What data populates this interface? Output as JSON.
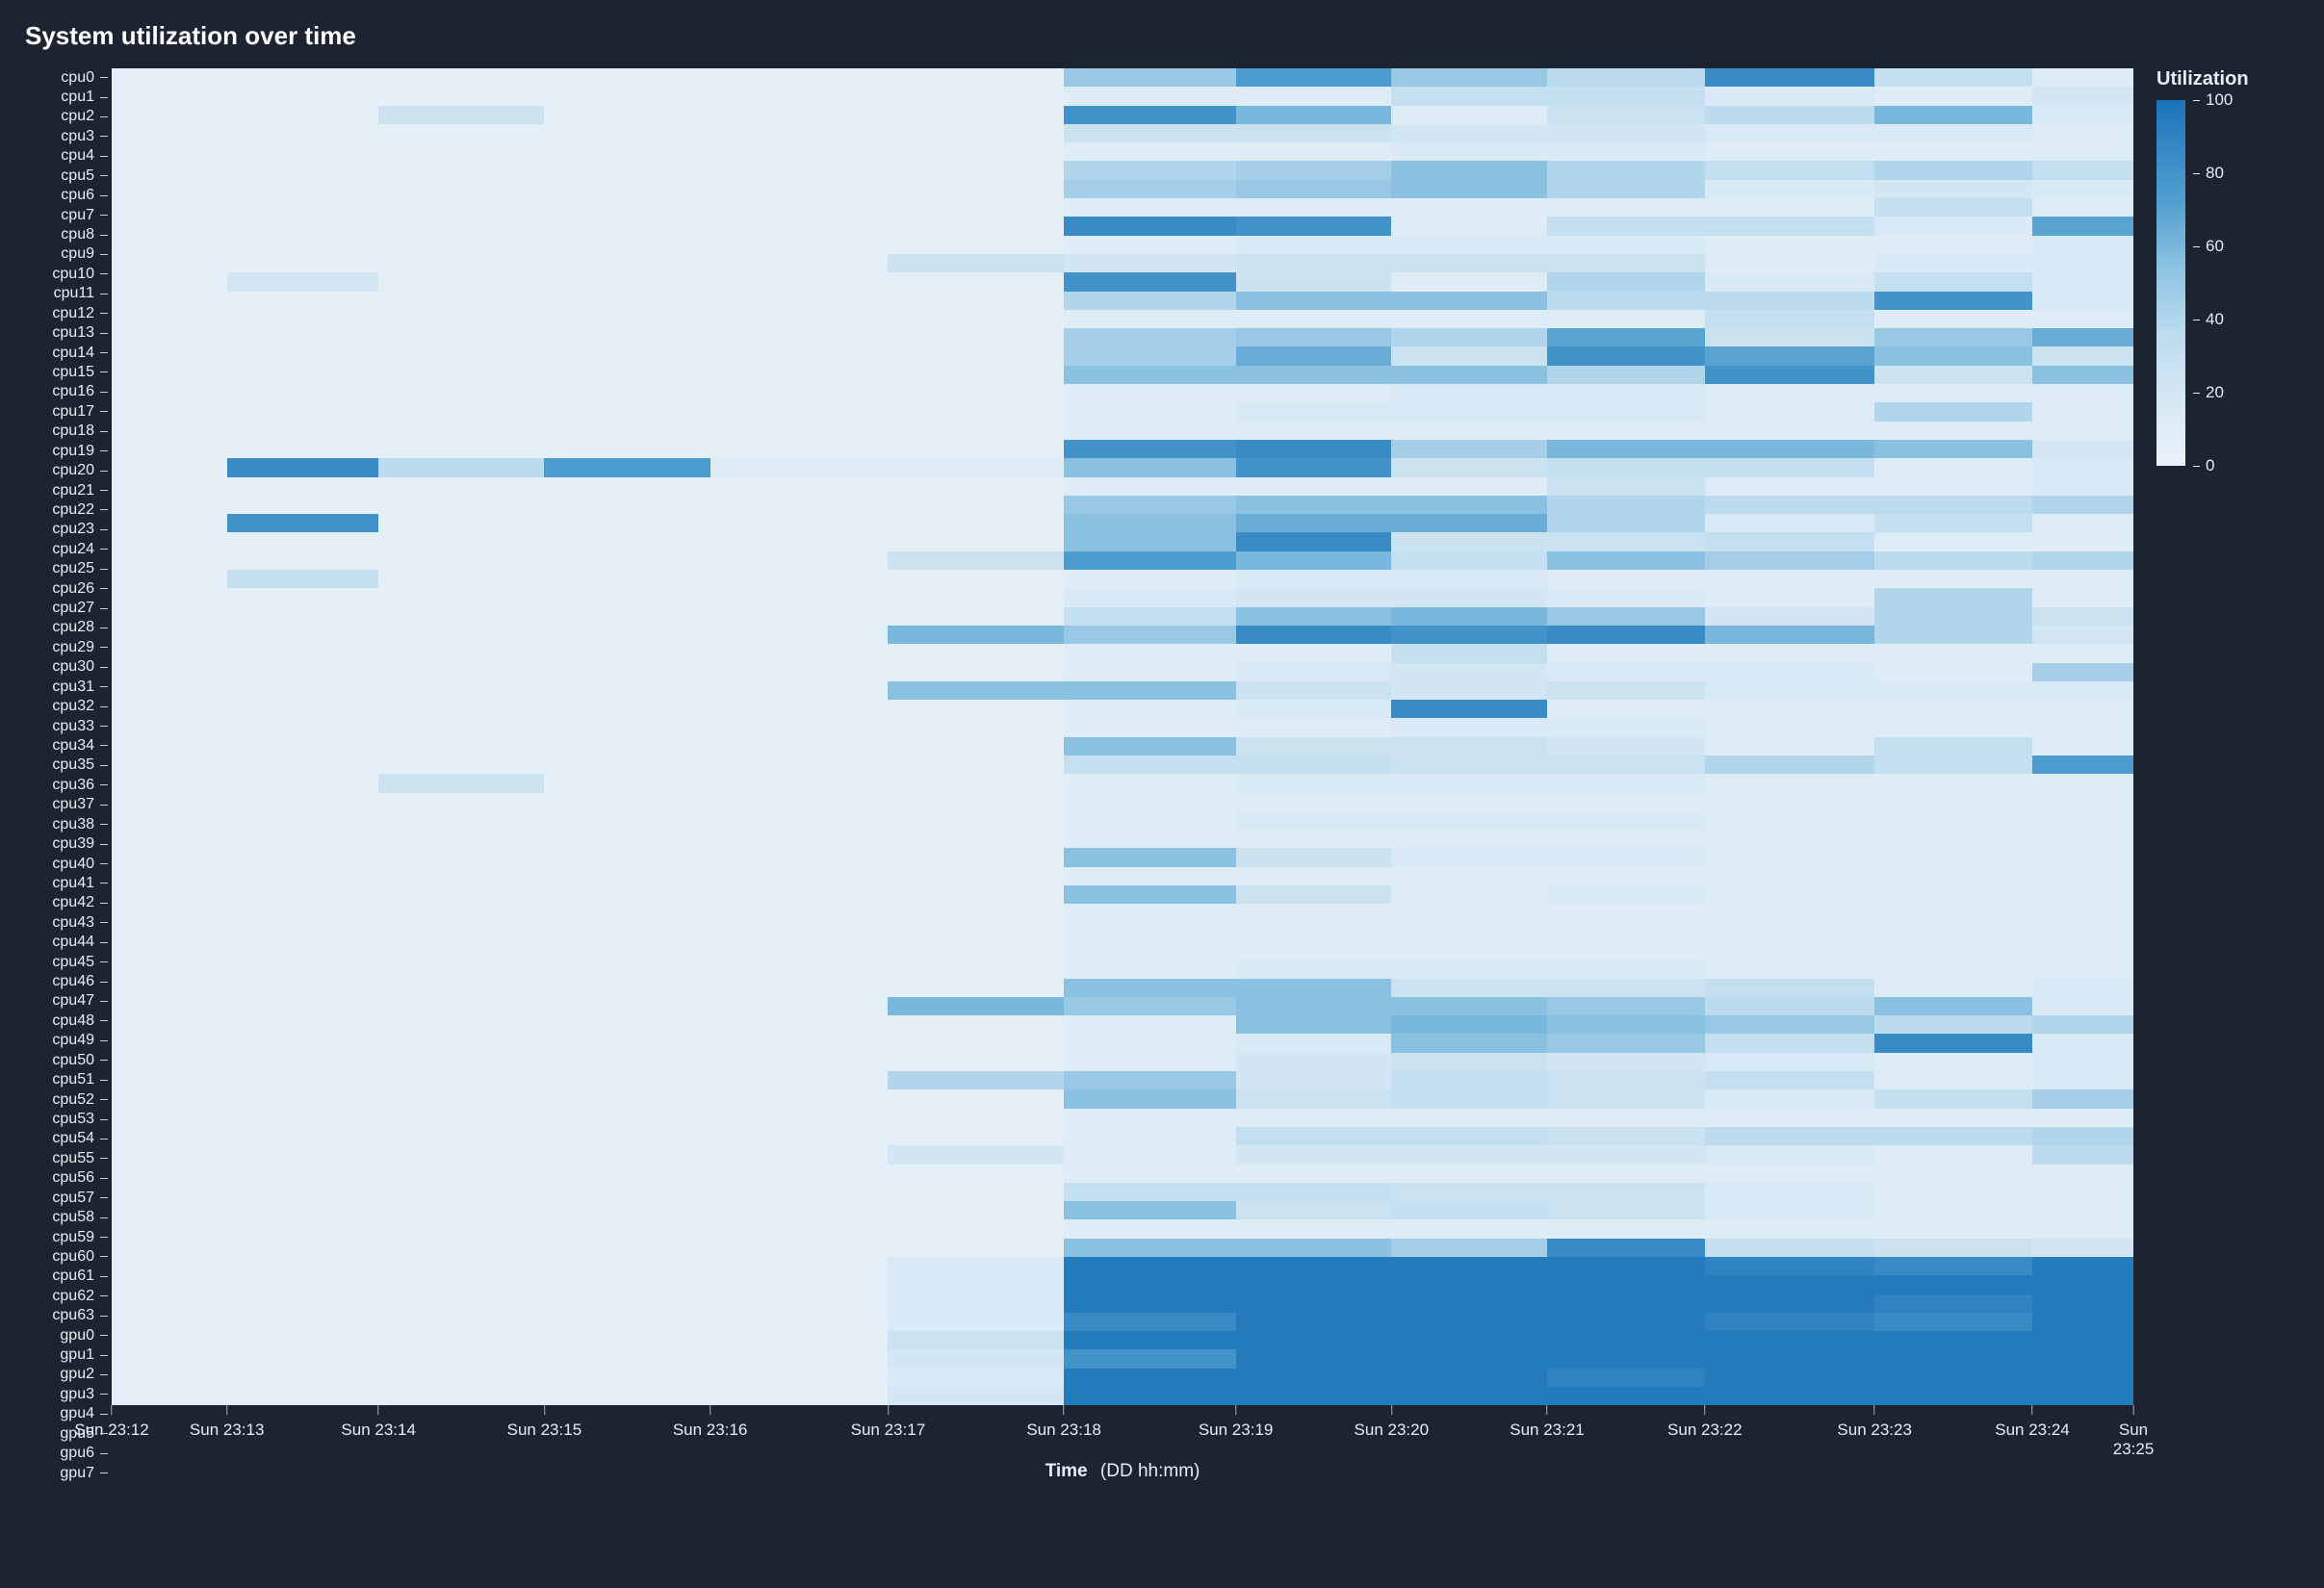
{
  "title": "System utilization over time",
  "xaxis_label_bold": "Time",
  "xaxis_label_rest": "(DD hh:mm)",
  "legend": {
    "title": "Utilization",
    "ticks": [
      0,
      20,
      40,
      60,
      80,
      100
    ],
    "min": 0,
    "max": 100
  },
  "chart_data": {
    "type": "heatmap",
    "title": "System utilization over time",
    "xlabel": "Time (DD hh:mm)",
    "legend_label": "Utilization",
    "color_scale": {
      "min": 0,
      "max": 100
    },
    "x_categories": [
      "Sun 23:12",
      "Sun 23:13",
      "Sun 23:14",
      "Sun 23:15",
      "Sun 23:16",
      "Sun 23:17",
      "Sun 23:18",
      "Sun 23:19",
      "Sun 23:20",
      "Sun 23:21",
      "Sun 23:22",
      "Sun 23:23",
      "Sun 23:24",
      "Sun 23:25"
    ],
    "x_tick_positions_pct": [
      0,
      5.7,
      13.2,
      21.4,
      29.6,
      38.4,
      47.1,
      55.6,
      63.3,
      71.0,
      78.8,
      87.2,
      95.0,
      100
    ],
    "col_widths_pct": [
      5.7,
      7.5,
      8.2,
      8.2,
      8.8,
      8.7,
      8.5,
      7.7,
      7.7,
      7.8,
      8.4,
      7.8,
      5.0,
      0
    ],
    "y_categories": [
      "cpu0",
      "cpu1",
      "cpu2",
      "cpu3",
      "cpu4",
      "cpu5",
      "cpu6",
      "cpu7",
      "cpu8",
      "cpu9",
      "cpu10",
      "cpu11",
      "cpu12",
      "cpu13",
      "cpu14",
      "cpu15",
      "cpu16",
      "cpu17",
      "cpu18",
      "cpu19",
      "cpu20",
      "cpu21",
      "cpu22",
      "cpu23",
      "cpu24",
      "cpu25",
      "cpu26",
      "cpu27",
      "cpu28",
      "cpu29",
      "cpu30",
      "cpu31",
      "cpu32",
      "cpu33",
      "cpu34",
      "cpu35",
      "cpu36",
      "cpu37",
      "cpu38",
      "cpu39",
      "cpu40",
      "cpu41",
      "cpu42",
      "cpu43",
      "cpu44",
      "cpu45",
      "cpu46",
      "cpu47",
      "cpu48",
      "cpu49",
      "cpu50",
      "cpu51",
      "cpu52",
      "cpu53",
      "cpu54",
      "cpu55",
      "cpu56",
      "cpu57",
      "cpu58",
      "cpu59",
      "cpu60",
      "cpu61",
      "cpu62",
      "cpu63",
      "gpu0",
      "gpu1",
      "gpu2",
      "gpu3",
      "gpu4",
      "gpu5",
      "gpu6",
      "gpu7"
    ],
    "values": [
      [
        5,
        5,
        5,
        5,
        5,
        5,
        50,
        75,
        50,
        35,
        85,
        30,
        10,
        10
      ],
      [
        5,
        5,
        5,
        5,
        5,
        5,
        10,
        10,
        30,
        30,
        15,
        10,
        20,
        10
      ],
      [
        5,
        5,
        25,
        5,
        5,
        5,
        80,
        60,
        10,
        25,
        35,
        60,
        15,
        15
      ],
      [
        5,
        5,
        5,
        5,
        5,
        5,
        25,
        25,
        20,
        20,
        15,
        15,
        10,
        10
      ],
      [
        5,
        5,
        5,
        5,
        5,
        5,
        10,
        10,
        15,
        15,
        10,
        10,
        10,
        10
      ],
      [
        5,
        5,
        5,
        5,
        5,
        5,
        40,
        45,
        55,
        40,
        30,
        40,
        30,
        30
      ],
      [
        5,
        5,
        5,
        5,
        5,
        5,
        45,
        50,
        55,
        40,
        15,
        20,
        15,
        15
      ],
      [
        5,
        5,
        5,
        5,
        5,
        5,
        10,
        10,
        10,
        10,
        10,
        30,
        10,
        10
      ],
      [
        5,
        5,
        5,
        5,
        5,
        5,
        85,
        80,
        10,
        30,
        30,
        15,
        70,
        60
      ],
      [
        5,
        5,
        5,
        5,
        5,
        5,
        10,
        15,
        15,
        15,
        10,
        10,
        15,
        15
      ],
      [
        5,
        5,
        5,
        5,
        5,
        25,
        20,
        25,
        25,
        25,
        10,
        15,
        15,
        15
      ],
      [
        5,
        20,
        5,
        5,
        5,
        5,
        80,
        25,
        10,
        40,
        15,
        30,
        15,
        15
      ],
      [
        5,
        5,
        5,
        5,
        5,
        5,
        40,
        55,
        55,
        35,
        35,
        80,
        15,
        15
      ],
      [
        5,
        5,
        5,
        5,
        5,
        5,
        10,
        10,
        10,
        10,
        30,
        10,
        10,
        10
      ],
      [
        5,
        5,
        5,
        5,
        5,
        5,
        45,
        50,
        40,
        70,
        25,
        50,
        65,
        15
      ],
      [
        5,
        5,
        5,
        5,
        5,
        5,
        45,
        65,
        25,
        80,
        70,
        55,
        25,
        60
      ],
      [
        5,
        5,
        5,
        5,
        5,
        5,
        55,
        55,
        55,
        40,
        80,
        25,
        55,
        15
      ],
      [
        5,
        5,
        5,
        5,
        5,
        5,
        10,
        10,
        15,
        15,
        10,
        10,
        10,
        10
      ],
      [
        5,
        5,
        5,
        5,
        5,
        5,
        10,
        15,
        15,
        15,
        10,
        40,
        10,
        10
      ],
      [
        5,
        5,
        5,
        5,
        5,
        5,
        10,
        10,
        10,
        10,
        10,
        10,
        10,
        10
      ],
      [
        5,
        5,
        5,
        5,
        5,
        5,
        80,
        85,
        45,
        60,
        60,
        55,
        20,
        70
      ],
      [
        5,
        85,
        35,
        75,
        10,
        10,
        55,
        80,
        25,
        30,
        30,
        10,
        15,
        15
      ],
      [
        5,
        5,
        5,
        5,
        5,
        5,
        10,
        10,
        10,
        25,
        10,
        10,
        15,
        15
      ],
      [
        5,
        5,
        5,
        5,
        5,
        5,
        50,
        55,
        55,
        40,
        35,
        35,
        40,
        20
      ],
      [
        5,
        80,
        5,
        5,
        5,
        5,
        55,
        65,
        65,
        40,
        15,
        30,
        10,
        10
      ],
      [
        5,
        5,
        5,
        5,
        5,
        5,
        55,
        85,
        25,
        25,
        30,
        10,
        10,
        10
      ],
      [
        5,
        5,
        5,
        5,
        5,
        25,
        75,
        60,
        30,
        55,
        45,
        35,
        40,
        20
      ],
      [
        5,
        30,
        5,
        5,
        5,
        5,
        10,
        15,
        15,
        10,
        10,
        10,
        10,
        10
      ],
      [
        5,
        5,
        5,
        5,
        5,
        5,
        15,
        20,
        20,
        15,
        10,
        40,
        10,
        10
      ],
      [
        5,
        5,
        5,
        5,
        5,
        5,
        30,
        55,
        60,
        50,
        20,
        40,
        25,
        65
      ],
      [
        5,
        5,
        5,
        5,
        5,
        60,
        50,
        85,
        80,
        85,
        60,
        40,
        20,
        15
      ],
      [
        5,
        5,
        5,
        5,
        5,
        5,
        10,
        10,
        30,
        10,
        10,
        10,
        10,
        10
      ],
      [
        5,
        5,
        5,
        5,
        5,
        5,
        10,
        15,
        20,
        15,
        15,
        10,
        45,
        75
      ],
      [
        5,
        5,
        5,
        5,
        5,
        55,
        55,
        25,
        20,
        25,
        15,
        15,
        15,
        15
      ],
      [
        5,
        5,
        5,
        5,
        5,
        5,
        10,
        15,
        85,
        10,
        10,
        10,
        10,
        10
      ],
      [
        5,
        5,
        5,
        5,
        5,
        5,
        10,
        10,
        15,
        15,
        10,
        10,
        10,
        10
      ],
      [
        5,
        5,
        5,
        5,
        5,
        5,
        55,
        25,
        25,
        20,
        10,
        30,
        10,
        10
      ],
      [
        5,
        5,
        5,
        5,
        5,
        5,
        30,
        30,
        25,
        25,
        40,
        30,
        75,
        10
      ],
      [
        5,
        5,
        25,
        5,
        5,
        5,
        10,
        15,
        15,
        15,
        10,
        10,
        10,
        10
      ],
      [
        5,
        5,
        5,
        5,
        5,
        5,
        10,
        10,
        10,
        10,
        10,
        10,
        10,
        10
      ],
      [
        5,
        5,
        5,
        5,
        5,
        5,
        10,
        15,
        15,
        15,
        10,
        10,
        10,
        10
      ],
      [
        5,
        5,
        5,
        5,
        5,
        5,
        10,
        10,
        10,
        10,
        10,
        10,
        10,
        10
      ],
      [
        5,
        5,
        5,
        5,
        5,
        5,
        55,
        25,
        15,
        15,
        10,
        10,
        10,
        10
      ],
      [
        5,
        5,
        5,
        5,
        5,
        5,
        10,
        10,
        10,
        10,
        10,
        10,
        10,
        10
      ],
      [
        5,
        5,
        5,
        5,
        5,
        5,
        55,
        25,
        10,
        15,
        10,
        10,
        10,
        10
      ],
      [
        5,
        5,
        5,
        5,
        5,
        5,
        10,
        10,
        10,
        10,
        10,
        10,
        10,
        10
      ],
      [
        5,
        5,
        5,
        5,
        5,
        5,
        10,
        10,
        10,
        10,
        10,
        10,
        10,
        10
      ],
      [
        5,
        5,
        5,
        5,
        5,
        5,
        10,
        10,
        10,
        10,
        10,
        10,
        10,
        10
      ],
      [
        5,
        5,
        5,
        5,
        5,
        5,
        10,
        15,
        15,
        15,
        10,
        10,
        10,
        10
      ],
      [
        5,
        5,
        5,
        5,
        5,
        5,
        55,
        55,
        25,
        25,
        30,
        10,
        15,
        15
      ],
      [
        5,
        5,
        5,
        5,
        5,
        60,
        50,
        55,
        55,
        50,
        35,
        55,
        15,
        15
      ],
      [
        5,
        5,
        5,
        5,
        5,
        5,
        10,
        55,
        60,
        55,
        50,
        35,
        40,
        15
      ],
      [
        5,
        5,
        5,
        5,
        5,
        5,
        10,
        15,
        55,
        50,
        30,
        85,
        15,
        15
      ],
      [
        5,
        5,
        5,
        5,
        5,
        5,
        10,
        20,
        25,
        20,
        15,
        10,
        15,
        15
      ],
      [
        5,
        5,
        5,
        5,
        5,
        40,
        50,
        20,
        30,
        25,
        30,
        10,
        15,
        15
      ],
      [
        5,
        5,
        5,
        5,
        5,
        5,
        55,
        25,
        30,
        25,
        15,
        30,
        45,
        10
      ],
      [
        5,
        5,
        5,
        5,
        5,
        5,
        10,
        10,
        10,
        10,
        10,
        10,
        10,
        10
      ],
      [
        5,
        5,
        5,
        5,
        5,
        5,
        10,
        30,
        30,
        25,
        35,
        35,
        40,
        10
      ],
      [
        5,
        5,
        5,
        5,
        5,
        20,
        10,
        20,
        20,
        20,
        15,
        10,
        35,
        10
      ],
      [
        5,
        5,
        5,
        5,
        5,
        5,
        10,
        10,
        10,
        10,
        10,
        10,
        10,
        10
      ],
      [
        5,
        5,
        5,
        5,
        5,
        5,
        30,
        30,
        25,
        25,
        15,
        10,
        10,
        10
      ],
      [
        5,
        5,
        5,
        5,
        5,
        5,
        55,
        25,
        30,
        25,
        15,
        10,
        10,
        10
      ],
      [
        5,
        5,
        5,
        5,
        5,
        5,
        10,
        10,
        10,
        10,
        10,
        10,
        10,
        10
      ],
      [
        5,
        5,
        5,
        5,
        5,
        5,
        55,
        55,
        45,
        85,
        30,
        25,
        20,
        15
      ],
      [
        5,
        5,
        5,
        5,
        5,
        15,
        95,
        95,
        95,
        95,
        90,
        85,
        95,
        95
      ],
      [
        5,
        5,
        5,
        5,
        5,
        15,
        95,
        95,
        95,
        95,
        95,
        95,
        95,
        95
      ],
      [
        5,
        5,
        5,
        5,
        5,
        15,
        95,
        95,
        95,
        95,
        95,
        90,
        95,
        95
      ],
      [
        5,
        5,
        5,
        5,
        5,
        15,
        85,
        95,
        95,
        95,
        90,
        85,
        95,
        95
      ],
      [
        5,
        5,
        5,
        5,
        5,
        25,
        95,
        95,
        95,
        95,
        95,
        95,
        95,
        95
      ],
      [
        5,
        5,
        5,
        5,
        5,
        20,
        80,
        95,
        95,
        95,
        95,
        95,
        95,
        95
      ],
      [
        5,
        5,
        5,
        5,
        5,
        15,
        95,
        95,
        95,
        90,
        95,
        95,
        95,
        95
      ],
      [
        5,
        5,
        5,
        5,
        5,
        20,
        95,
        95,
        95,
        95,
        95,
        95,
        95,
        95
      ]
    ]
  }
}
